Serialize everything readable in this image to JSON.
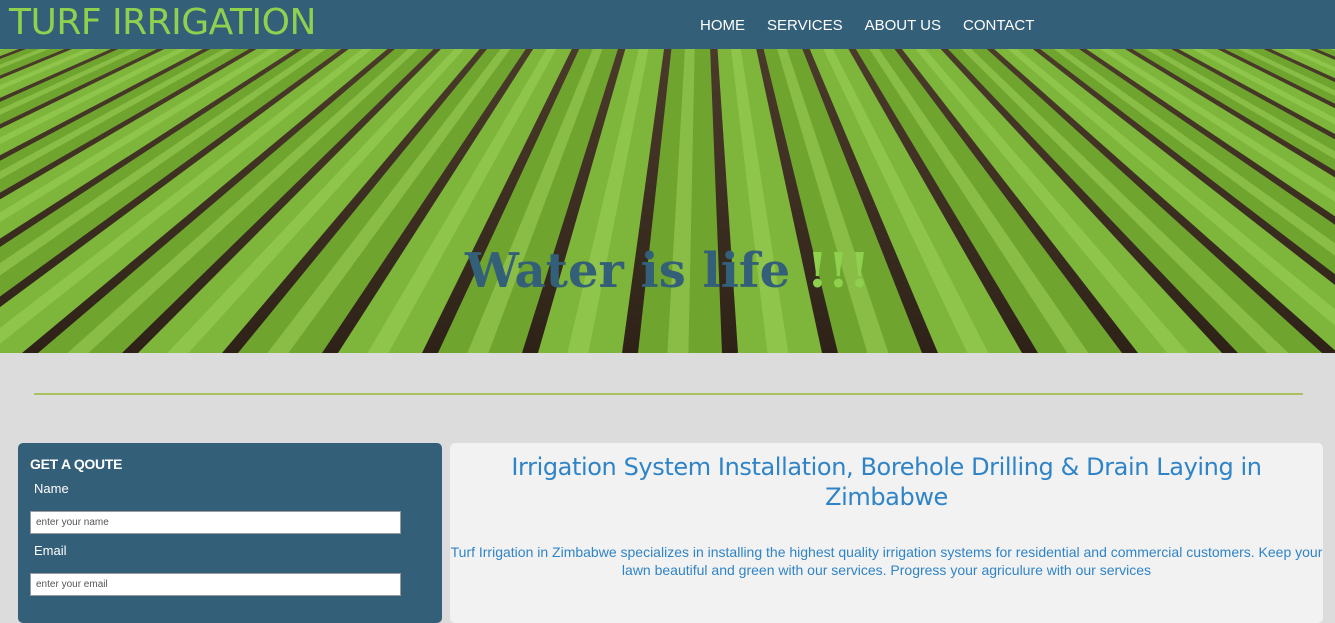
{
  "brand": {
    "name": "TURF IRRIGATION"
  },
  "nav": {
    "items": [
      "HOME",
      "SERVICES",
      "ABOUT US",
      "CONTACT"
    ]
  },
  "hero": {
    "title_main": "Water is life ",
    "title_accent": "!!!"
  },
  "quote_form": {
    "title": "GET A QOUTE",
    "name_label": "Name",
    "name_placeholder": "enter your name",
    "email_label": "Email",
    "email_placeholder": "enter your email"
  },
  "content": {
    "heading": "Irrigation System Installation, Borehole Drilling & Drain Laying in Zimbabwe",
    "paragraph": "Turf Irrigation in Zimbabwe specializes in installing the highest quality irrigation systems for residential and commercial customers. Keep your lawn beautiful and green with our services. Progress your agriculure with our services"
  },
  "colors": {
    "navbar": "#345f78",
    "brand": "#8fd14f",
    "accent_link": "#2f84c7",
    "divider": "#a9c160",
    "page_background": "#dcdcdc"
  }
}
